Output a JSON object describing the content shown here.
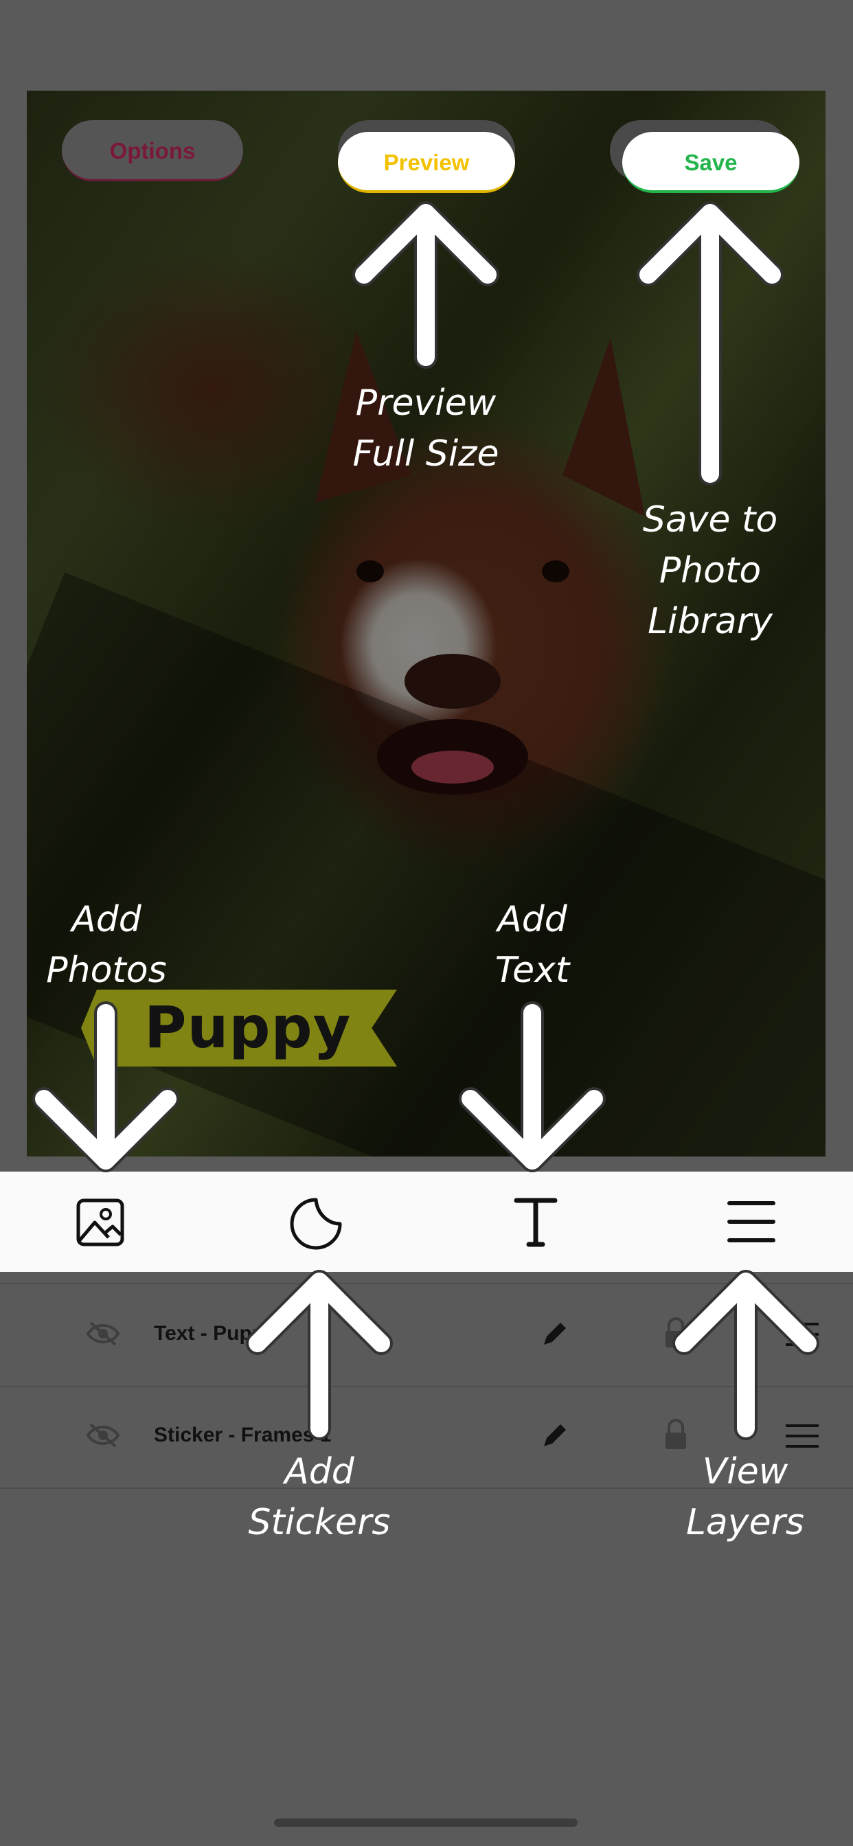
{
  "top_buttons": {
    "options": "Options",
    "preview": "Preview",
    "save": "Save"
  },
  "canvas": {
    "sticker_text": "Puppy"
  },
  "layers": [
    {
      "name": "Text - Puppy",
      "visible_text": "Text - Pupp"
    },
    {
      "name": "Sticker - Frames 1",
      "visible_text": "Sticker - Frames 1"
    }
  ],
  "coach_marks": {
    "preview": [
      "Preview",
      "Full Size"
    ],
    "save": [
      "Save to",
      "Photo",
      "Library"
    ],
    "add_photos": [
      "Add",
      "Photos"
    ],
    "add_text": [
      "Add",
      "Text"
    ],
    "add_stickers": [
      "Add",
      "Stickers"
    ],
    "view_layers": [
      "View",
      "Layers"
    ]
  },
  "toolbar_icons": [
    "photo-icon",
    "sticker-icon",
    "text-icon",
    "layers-icon"
  ],
  "colors": {
    "options": "#7a1838",
    "preview": "#f2c200",
    "save": "#23b54b",
    "overlay": "#5a5a5a",
    "sticker_banner": "#7f8412"
  }
}
